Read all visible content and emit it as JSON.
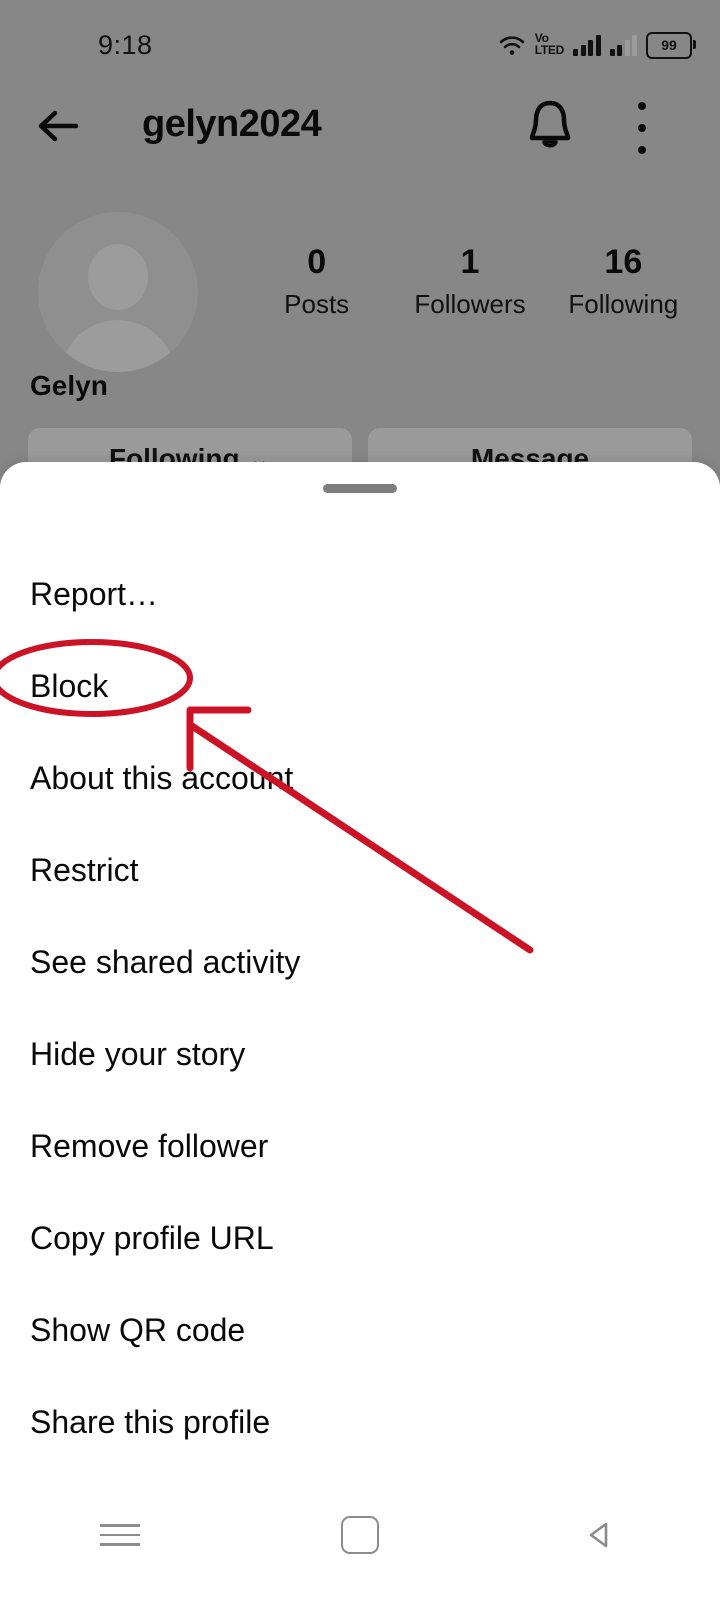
{
  "status_bar": {
    "time": "9:18",
    "wifi_icon": "wifi-icon",
    "volte_top": "Vo",
    "volte_bottom": "LTE",
    "volte_suffix": "D",
    "signal_icon_1": "signal-bars-icon",
    "signal_icon_2": "signal-bars-icon",
    "battery_level": "99"
  },
  "header": {
    "back_icon": "back-arrow-icon",
    "title": "gelyn2024",
    "bell_icon": "bell-icon",
    "overflow_icon": "overflow-menu-icon"
  },
  "profile": {
    "avatar_icon": "default-avatar-icon",
    "display_name": "Gelyn",
    "stats": [
      {
        "value": "0",
        "label": "Posts"
      },
      {
        "value": "1",
        "label": "Followers"
      },
      {
        "value": "16",
        "label": "Following"
      }
    ],
    "actions": [
      {
        "label": "Following",
        "chevron": "⌄"
      },
      {
        "label": "Message",
        "chevron": ""
      }
    ]
  },
  "bottom_sheet": {
    "drag_handle": "drag-handle",
    "items": [
      {
        "label": "Report…",
        "name": "report"
      },
      {
        "label": "Block",
        "name": "block",
        "highlighted": true
      },
      {
        "label": "About this account",
        "name": "about-this-account"
      },
      {
        "label": "Restrict",
        "name": "restrict"
      },
      {
        "label": "See shared activity",
        "name": "see-shared-activity"
      },
      {
        "label": "Hide your story",
        "name": "hide-your-story"
      },
      {
        "label": "Remove follower",
        "name": "remove-follower"
      },
      {
        "label": "Copy profile URL",
        "name": "copy-profile-url"
      },
      {
        "label": "Show QR code",
        "name": "show-qr-code"
      },
      {
        "label": "Share this profile",
        "name": "share-this-profile"
      }
    ]
  },
  "nav_bar": {
    "recents_icon": "recents-icon",
    "home_icon": "home-icon",
    "back_icon": "nav-back-icon"
  },
  "annotation": {
    "color": "#cc1326",
    "ellipse_target": "Block",
    "arrow_label": "arrow pointing to Block"
  }
}
